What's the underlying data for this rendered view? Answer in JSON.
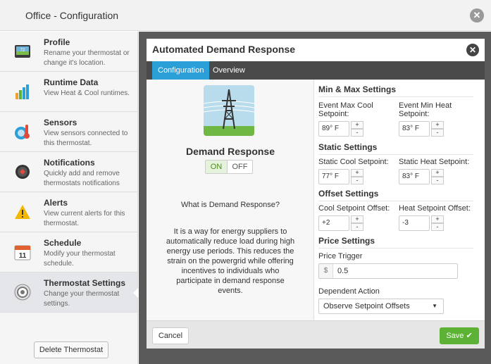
{
  "window": {
    "title": "Office - Configuration"
  },
  "sidebar": {
    "items": [
      {
        "title": "Profile",
        "description": "Rename your thermostat or change it's location.",
        "icon": "thermostat-profile-icon"
      },
      {
        "title": "Runtime Data",
        "description": "View Heat & Cool runtimes.",
        "icon": "bar-chart-icon"
      },
      {
        "title": "Sensors",
        "description": "View sensors connected to this thermostat.",
        "icon": "sensor-icon"
      },
      {
        "title": "Notifications",
        "description": "Quickly add and remove thermostats notifications",
        "icon": "notification-icon"
      },
      {
        "title": "Alerts",
        "description": "View current alerts for this thermostat.",
        "icon": "warning-icon"
      },
      {
        "title": "Schedule",
        "description": "Modify your thermostat schedule.",
        "icon": "calendar-icon",
        "day": "11"
      },
      {
        "title": "Thermostat Settings",
        "description": "Change your thermostat settings.",
        "icon": "settings-icon",
        "active": true
      }
    ],
    "delete_label": "Delete Thermostat"
  },
  "modal": {
    "title": "Automated Demand Response",
    "tabs": [
      {
        "label": "Configuration",
        "active": true
      },
      {
        "label": "Overview",
        "active": false
      }
    ],
    "left": {
      "title": "Demand Response",
      "toggle_on": "ON",
      "toggle_off": "OFF",
      "toggle_state": "ON",
      "question": "What is Demand Response?",
      "description": "It is a way for energy suppliers to automatically reduce load during high energy use periods. This reduces the strain on the powergrid while offering incentives to individuals who participate in demand response events."
    },
    "right": {
      "minmax": {
        "heading": "Min & Max Settings",
        "max_cool_label": "Event Max Cool Setpoint:",
        "max_cool_value": "89° F",
        "min_heat_label": "Event Min Heat Setpoint:",
        "min_heat_value": "83° F"
      },
      "static": {
        "heading": "Static Settings",
        "cool_label": "Static Cool Setpoint:",
        "cool_value": "77° F",
        "heat_label": "Static Heat Setpoint:",
        "heat_value": "83° F"
      },
      "offset": {
        "heading": "Offset Settings",
        "cool_label": "Cool Setpoint Offset:",
        "cool_value": "+2",
        "heat_label": "Heat Setpoint Offset:",
        "heat_value": "-3"
      },
      "price": {
        "heading": "Price Settings",
        "trigger_label": "Price Trigger",
        "currency": "$",
        "trigger_value": "0.5",
        "action_label": "Dependent Action",
        "action_value": "Observe Setpoint Offsets"
      },
      "stepper_up": "+",
      "stepper_down": "-"
    },
    "footer": {
      "cancel_label": "Cancel",
      "save_label": "Save"
    }
  },
  "colors": {
    "accent": "#2a9fd8",
    "save": "#5cb234",
    "tab_bar": "#4a4a4a"
  }
}
